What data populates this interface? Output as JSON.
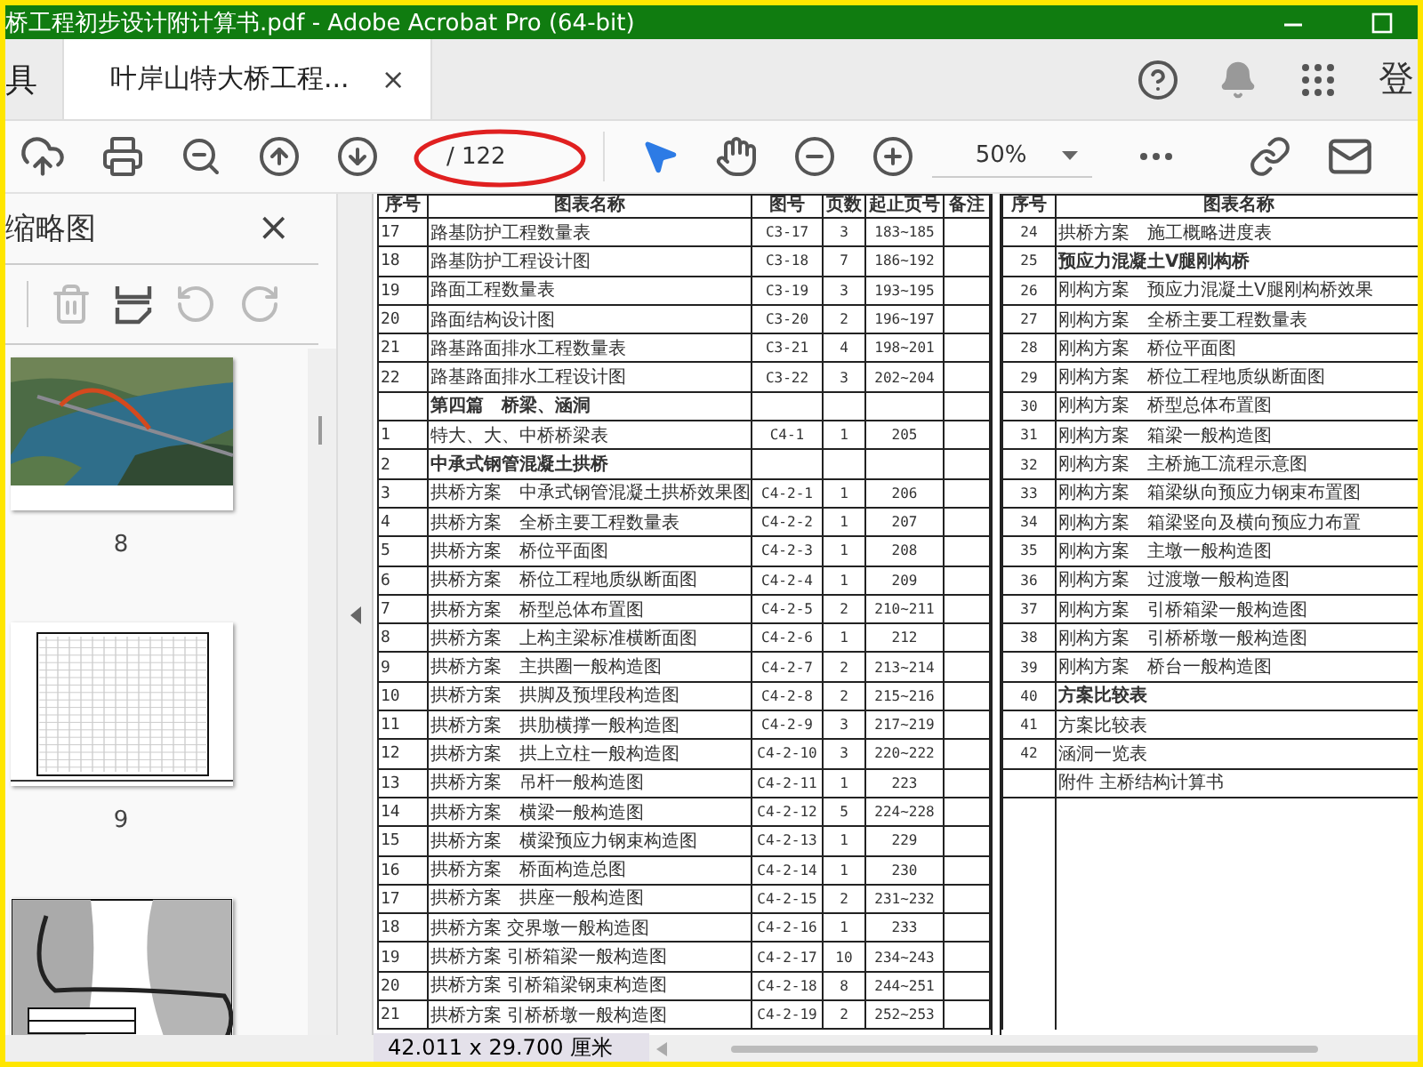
{
  "window": {
    "title": "桥工程初步设计附计算书.pdf - Adobe Acrobat Pro (64-bit)"
  },
  "tabs": [
    {
      "label": "具",
      "selected": false
    },
    {
      "label": "叶岸山特大桥工程...",
      "selected": true,
      "close": "×"
    }
  ],
  "account": {
    "label": "登"
  },
  "toolbar": {
    "page_total": "/ 122",
    "zoom": "50%"
  },
  "thumbnails": {
    "title": "缩略图",
    "close": "×",
    "pages": [
      {
        "label": "8"
      },
      {
        "kind": "grid",
        "label": "9"
      },
      {
        "kind": "map"
      }
    ]
  },
  "document": {
    "left_table": {
      "columns": [
        "序号",
        "图表名称",
        "图号",
        "页数",
        "起止页号",
        "备注"
      ],
      "rows": [
        {
          "kind": "item",
          "no": "17",
          "name": "路基防护工程数量表",
          "code": "C3-17",
          "pages": "3",
          "range": "183~185"
        },
        {
          "kind": "item",
          "no": "18",
          "name": "路基防护工程设计图",
          "code": "C3-18",
          "pages": "7",
          "range": "186~192"
        },
        {
          "kind": "item",
          "no": "19",
          "name": "路面工程数量表",
          "code": "C3-19",
          "pages": "3",
          "range": "193~195"
        },
        {
          "kind": "item",
          "no": "20",
          "name": "路面结构设计图",
          "code": "C3-20",
          "pages": "2",
          "range": "196~197"
        },
        {
          "kind": "item",
          "no": "21",
          "name": "路基路面排水工程数量表",
          "code": "C3-21",
          "pages": "4",
          "range": "198~201"
        },
        {
          "kind": "item",
          "no": "22",
          "name": "路基路面排水工程设计图",
          "code": "C3-22",
          "pages": "3",
          "range": "202~204"
        },
        {
          "kind": "section",
          "name": "第四篇　桥梁、涵洞"
        },
        {
          "kind": "item",
          "no": "1",
          "name": "特大、大、中桥桥梁表",
          "code": "C4-1",
          "pages": "1",
          "range": "205"
        },
        {
          "kind": "section",
          "no": "2",
          "name": "中承式钢管混凝土拱桥"
        },
        {
          "kind": "item",
          "no": "3",
          "name": "拱桥方案　中承式钢管混凝土拱桥效果图",
          "code": "C4-2-1",
          "pages": "1",
          "range": "206"
        },
        {
          "kind": "item",
          "no": "4",
          "name": "拱桥方案　全桥主要工程数量表",
          "code": "C4-2-2",
          "pages": "1",
          "range": "207"
        },
        {
          "kind": "item",
          "no": "5",
          "name": "拱桥方案　桥位平面图",
          "code": "C4-2-3",
          "pages": "1",
          "range": "208"
        },
        {
          "kind": "item",
          "no": "6",
          "name": "拱桥方案　桥位工程地质纵断面图",
          "code": "C4-2-4",
          "pages": "1",
          "range": "209"
        },
        {
          "kind": "item",
          "no": "7",
          "name": "拱桥方案　桥型总体布置图",
          "code": "C4-2-5",
          "pages": "2",
          "range": "210~211"
        },
        {
          "kind": "item",
          "no": "8",
          "name": "拱桥方案　上构主梁标准横断面图",
          "code": "C4-2-6",
          "pages": "1",
          "range": "212"
        },
        {
          "kind": "item",
          "no": "9",
          "name": "拱桥方案　主拱圈一般构造图",
          "code": "C4-2-7",
          "pages": "2",
          "range": "213~214"
        },
        {
          "kind": "item",
          "no": "10",
          "name": "拱桥方案　拱脚及预埋段构造图",
          "code": "C4-2-8",
          "pages": "2",
          "range": "215~216"
        },
        {
          "kind": "item",
          "no": "11",
          "name": "拱桥方案　拱肋横撑一般构造图",
          "code": "C4-2-9",
          "pages": "3",
          "range": "217~219"
        },
        {
          "kind": "item",
          "no": "12",
          "name": "拱桥方案　拱上立柱一般构造图",
          "code": "C4-2-10",
          "pages": "3",
          "range": "220~222"
        },
        {
          "kind": "item",
          "no": "13",
          "name": "拱桥方案　吊杆一般构造图",
          "code": "C4-2-11",
          "pages": "1",
          "range": "223"
        },
        {
          "kind": "item",
          "no": "14",
          "name": "拱桥方案　横梁一般构造图",
          "code": "C4-2-12",
          "pages": "5",
          "range": "224~228"
        },
        {
          "kind": "item",
          "no": "15",
          "name": "拱桥方案　横梁预应力钢束构造图",
          "code": "C4-2-13",
          "pages": "1",
          "range": "229"
        },
        {
          "kind": "item",
          "no": "16",
          "name": "拱桥方案　桥面构造总图",
          "code": "C4-2-14",
          "pages": "1",
          "range": "230"
        },
        {
          "kind": "item",
          "no": "17",
          "name": "拱桥方案　拱座一般构造图",
          "code": "C4-2-15",
          "pages": "2",
          "range": "231~232"
        },
        {
          "kind": "item",
          "no": "18",
          "name": "拱桥方案 交界墩一般构造图",
          "code": "C4-2-16",
          "pages": "1",
          "range": "233"
        },
        {
          "kind": "item",
          "no": "19",
          "name": "拱桥方案 引桥箱梁一般构造图",
          "code": "C4-2-17",
          "pages": "10",
          "range": "234~243"
        },
        {
          "kind": "item",
          "no": "20",
          "name": "拱桥方案 引桥箱梁钢束构造图",
          "code": "C4-2-18",
          "pages": "8",
          "range": "244~251"
        },
        {
          "kind": "item",
          "no": "21",
          "name": "拱桥方案 引桥桥墩一般构造图",
          "code": "C4-2-19",
          "pages": "2",
          "range": "252~253"
        }
      ]
    },
    "right_table": {
      "columns": [
        "序号",
        "图表名称"
      ],
      "rows": [
        {
          "kind": "item",
          "no": "24",
          "name": "拱桥方案　施工概略进度表"
        },
        {
          "kind": "section",
          "no": "25",
          "name": "预应力混凝土V腿刚构桥"
        },
        {
          "kind": "item",
          "no": "26",
          "name": "刚构方案　预应力混凝土V腿刚构桥效果"
        },
        {
          "kind": "item",
          "no": "27",
          "name": "刚构方案　全桥主要工程数量表"
        },
        {
          "kind": "item",
          "no": "28",
          "name": "刚构方案　桥位平面图"
        },
        {
          "kind": "item",
          "no": "29",
          "name": "刚构方案　桥位工程地质纵断面图"
        },
        {
          "kind": "item",
          "no": "30",
          "name": "刚构方案　桥型总体布置图"
        },
        {
          "kind": "item",
          "no": "31",
          "name": "刚构方案　箱梁一般构造图"
        },
        {
          "kind": "item",
          "no": "32",
          "name": "刚构方案　主桥施工流程示意图"
        },
        {
          "kind": "item",
          "no": "33",
          "name": "刚构方案　箱梁纵向预应力钢束布置图"
        },
        {
          "kind": "item",
          "no": "34",
          "name": "刚构方案　箱梁竖向及横向预应力布置"
        },
        {
          "kind": "item",
          "no": "35",
          "name": "刚构方案　主墩一般构造图"
        },
        {
          "kind": "item",
          "no": "36",
          "name": "刚构方案　过渡墩一般构造图"
        },
        {
          "kind": "item",
          "no": "37",
          "name": "刚构方案　引桥箱梁一般构造图"
        },
        {
          "kind": "item",
          "no": "38",
          "name": "刚构方案　引桥桥墩一般构造图"
        },
        {
          "kind": "item",
          "no": "39",
          "name": "刚构方案　桥台一般构造图"
        },
        {
          "kind": "section",
          "no": "40",
          "name": "方案比较表"
        },
        {
          "kind": "item",
          "no": "41",
          "name": "方案比较表"
        },
        {
          "kind": "item",
          "no": "42",
          "name": "涵洞一览表"
        },
        {
          "kind": "item",
          "name": "附件 主桥结构计算书"
        }
      ]
    }
  },
  "status_bar": {
    "page_size": "42.011 x 29.700 厘米"
  }
}
